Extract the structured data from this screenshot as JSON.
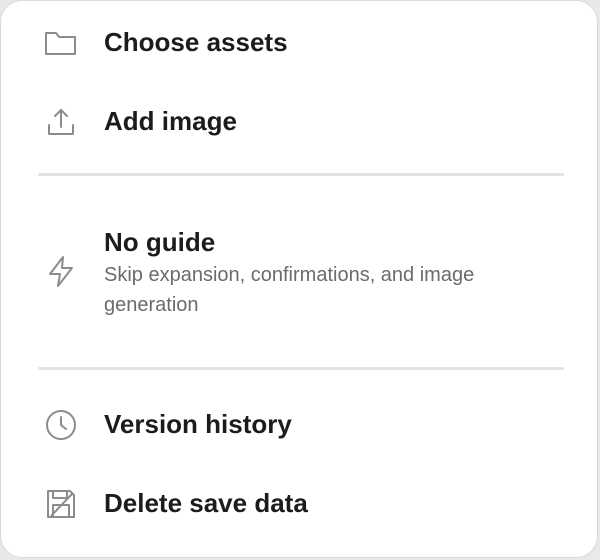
{
  "menu": {
    "items": [
      {
        "id": "choose-assets",
        "label": "Choose assets",
        "icon": "folder-icon"
      },
      {
        "id": "add-image",
        "label": "Add image",
        "icon": "upload-icon"
      },
      {
        "id": "no-guide",
        "label": "No guide",
        "description": "Skip expansion, confirmations, and image generation",
        "icon": "lightning-icon"
      },
      {
        "id": "version-history",
        "label": "Version history",
        "icon": "clock-icon"
      },
      {
        "id": "delete-save-data",
        "label": "Delete save data",
        "icon": "save-delete-icon"
      }
    ]
  },
  "colors": {
    "icon_stroke": "#8c8c8c",
    "label_text": "#1c1c1c",
    "description_text": "#6b6b6b",
    "divider": "#e3e3e3",
    "background": "#ffffff"
  }
}
